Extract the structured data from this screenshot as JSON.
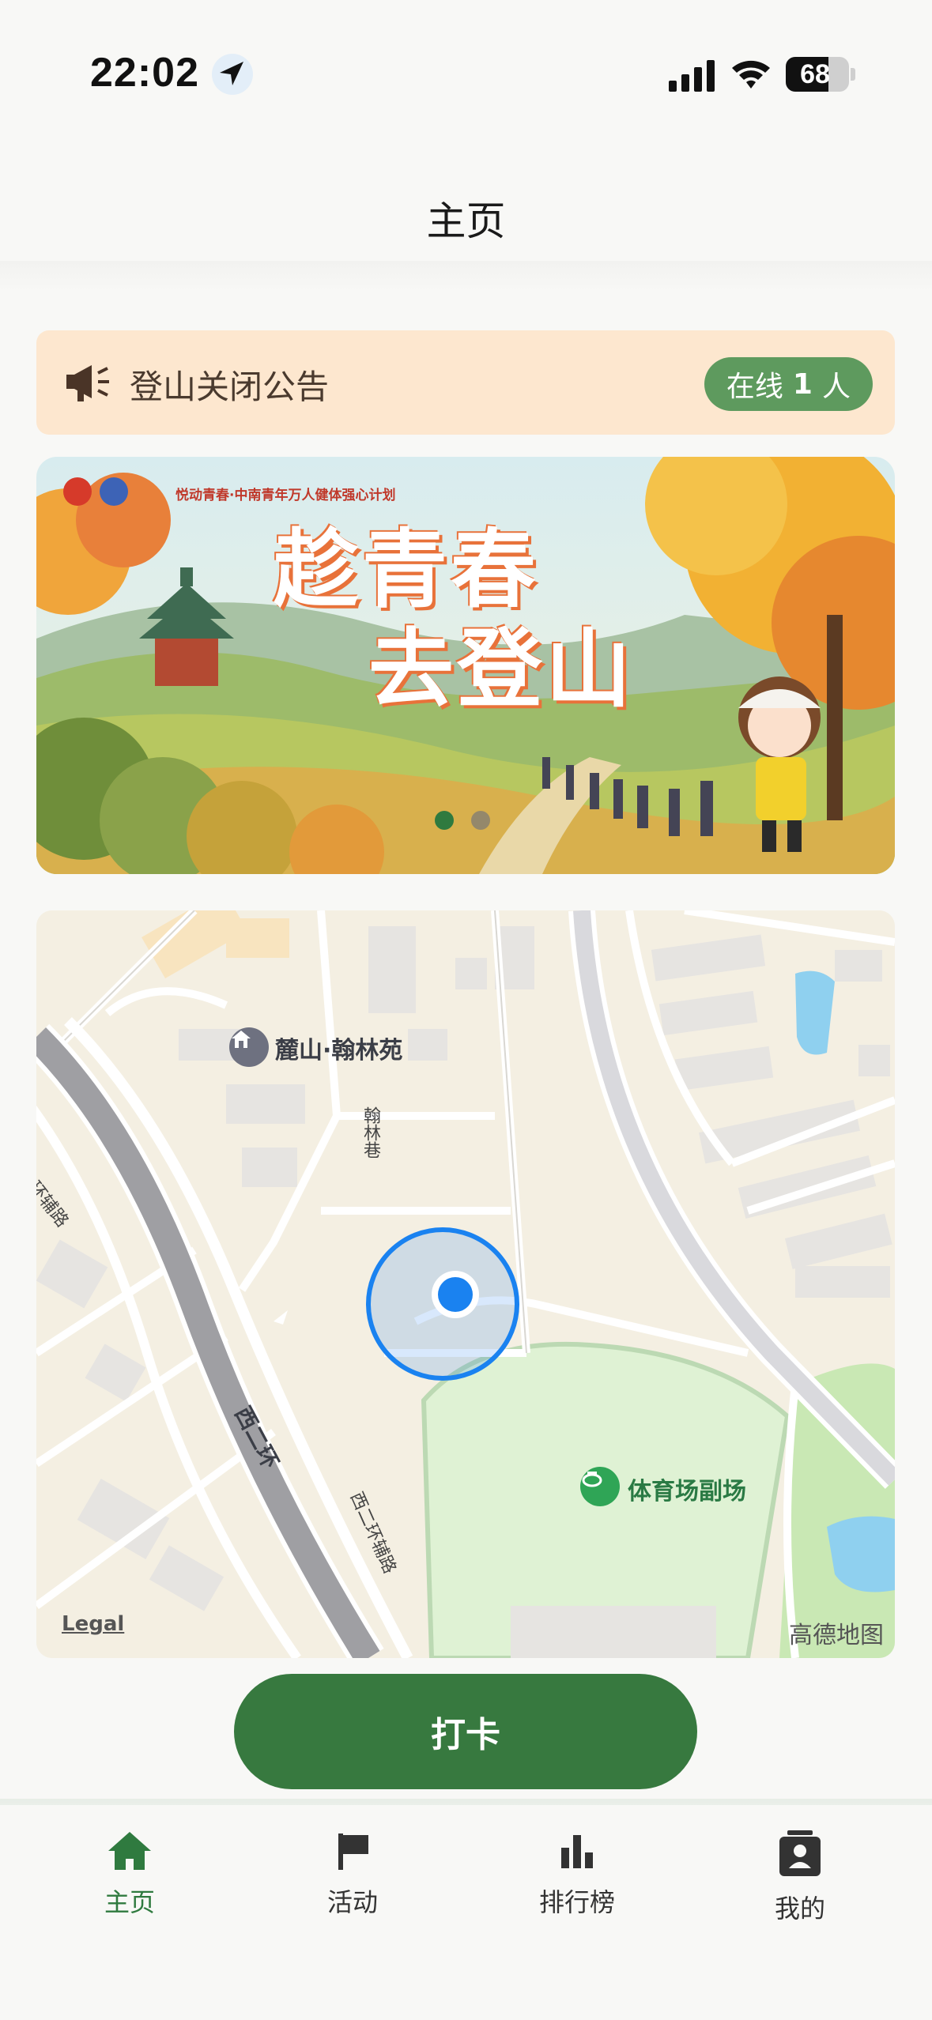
{
  "status_bar": {
    "time": "22:02",
    "battery": "68"
  },
  "header": {
    "title": "主页"
  },
  "notice": {
    "text": "登山关闭公告",
    "online_prefix": "在线",
    "online_count": "1",
    "online_suffix": "人"
  },
  "banner": {
    "title_line1": "趁青春",
    "title_line2": "去登山",
    "subtitle": "悦动青春·中南青年万人健体强心计划",
    "slide_count": 2,
    "active_slide": 1
  },
  "map": {
    "labels": {
      "residential": "麓山·翰林苑",
      "lane": "翰林巷",
      "ring_road": "西二环",
      "ring_aux_road_left": "西二环辅路",
      "ring_aux_road_right": "西二环辅路",
      "stadium": "体育场副场"
    },
    "legal": "Legal",
    "provider": "高德地图"
  },
  "checkin_button": {
    "label": "打卡"
  },
  "bottom_nav": {
    "items": [
      {
        "label": "主页",
        "icon": "home-icon",
        "active": true
      },
      {
        "label": "活动",
        "icon": "flag-icon",
        "active": false
      },
      {
        "label": "排行榜",
        "icon": "bar-chart-icon",
        "active": false
      },
      {
        "label": "我的",
        "icon": "profile-card-icon",
        "active": false
      }
    ]
  },
  "colors": {
    "primary_green": "#37793f",
    "notice_bg": "#fde7cf",
    "online_badge": "#5e9a5e",
    "location_blue": "#1a82f0"
  }
}
